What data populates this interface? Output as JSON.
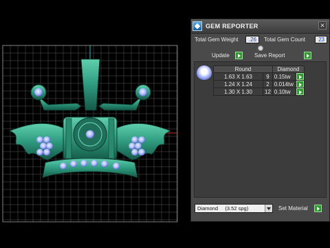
{
  "panel": {
    "title": "GEM REPORTER",
    "close_glyph": "✕",
    "total_weight_label": "Total Gem Weight",
    "total_weight_value": ".26",
    "total_count_label": "Total Gem Count",
    "total_count_value": "23",
    "update_label": "Update",
    "save_report_label": "Save Report",
    "table": {
      "header_shape": "Round",
      "header_material": "Diamond",
      "rows": [
        {
          "size": "1.63 X 1.63",
          "count": "9",
          "weight": "0.15tw"
        },
        {
          "size": "1.24 X 1.24",
          "count": "2",
          "weight": "0.014tw"
        },
        {
          "size": "1.30 X 1.30",
          "count": "12",
          "weight": "0.10tw"
        }
      ]
    },
    "material_select_value": "Diamond     (3.52 spg)",
    "set_material_label": "Set Material"
  },
  "colors": {
    "panel_bg": "#4a4a4a",
    "value_text": "#1b3bd0",
    "action_green": "#2f9a2f",
    "model_teal": "#2e9a7e",
    "gem_blue": "#a9b7ff"
  },
  "icons": {
    "app": "gem-reporter-icon",
    "close": "close-icon",
    "collapse": "collapse-arrow-icon",
    "action": "green-play-arrow-icon",
    "dropdown": "chevron-down-icon"
  }
}
